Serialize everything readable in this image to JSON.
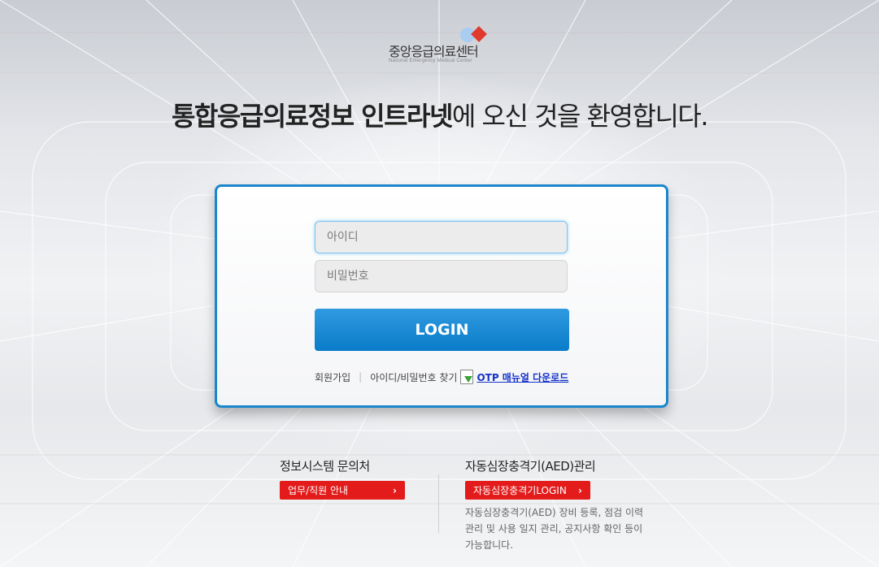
{
  "logo": {
    "name": "중앙응급의료센터",
    "subtitle": "National Emergency Medical Center"
  },
  "welcome": {
    "bold_part": "통합응급의료정보 인트라넷",
    "rest": "에 오신 것을 환영합니다."
  },
  "login": {
    "id_placeholder": "아이디",
    "pw_placeholder": "비밀번호",
    "button_label": "LOGIN",
    "links": {
      "signup": "회원가입",
      "separator": "|",
      "find": "아이디/비밀번호 찾기",
      "otp_manual": "OTP 매뉴얼 다운로드"
    }
  },
  "contact": {
    "title": "정보시스템 문의처",
    "button_label": "업무/직원 안내",
    "chevron": "›"
  },
  "aed": {
    "title": "자동심장충격기(AED)관리",
    "button_label": "자동심장충격기LOGIN",
    "chevron": "›",
    "description": "자동심장충격기(AED) 장비 등록, 점검 이력 관리 및 사용 일지 관리, 공지사항 확인 등이 가능합니다."
  },
  "colors": {
    "accent_blue": "#1a86cc",
    "button_red": "#e31b1b",
    "link_blue": "#1633c9"
  }
}
